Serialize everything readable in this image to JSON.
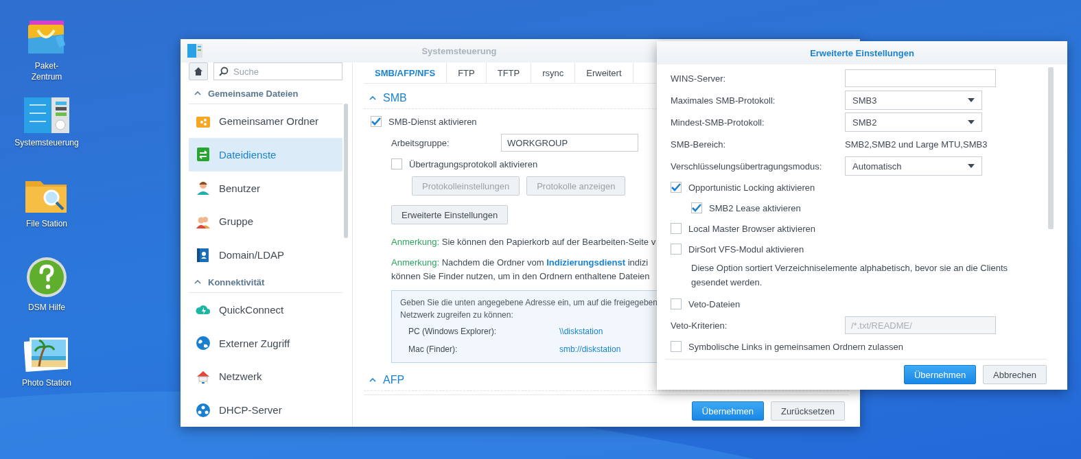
{
  "desktop_icons": [
    {
      "kind": "package",
      "label_lines": [
        "Paket-",
        "Zentrum"
      ]
    },
    {
      "kind": "control_panel",
      "label_lines": [
        "Systemsteuerung"
      ]
    },
    {
      "kind": "file_station",
      "label_lines": [
        "File Station"
      ]
    },
    {
      "kind": "help",
      "label_lines": [
        "DSM Hilfe"
      ]
    },
    {
      "kind": "photo",
      "label_lines": [
        "Photo Station"
      ]
    }
  ],
  "main_window": {
    "title": "Systemsteuerung",
    "search": {
      "placeholder": "Suche"
    },
    "sidebar": {
      "sections": [
        {
          "title": "Gemeinsame Dateien",
          "expanded": true,
          "items": [
            {
              "label": "Gemeinsamer Ordner",
              "selected": false
            },
            {
              "label": "Dateidienste",
              "selected": true
            },
            {
              "label": "Benutzer",
              "selected": false
            },
            {
              "label": "Gruppe",
              "selected": false
            },
            {
              "label": "Domain/LDAP",
              "selected": false
            }
          ]
        },
        {
          "title": "Konnektivität",
          "expanded": true,
          "items": [
            {
              "label": "QuickConnect",
              "selected": false
            },
            {
              "label": "Externer Zugriff",
              "selected": false
            },
            {
              "label": "Netzwerk",
              "selected": false
            },
            {
              "label": "DHCP-Server",
              "selected": false
            }
          ]
        }
      ]
    },
    "tabs": [
      {
        "label": "SMB/AFP/NFS",
        "selected": true
      },
      {
        "label": "FTP",
        "selected": false
      },
      {
        "label": "TFTP",
        "selected": false
      },
      {
        "label": "rsync",
        "selected": false
      },
      {
        "label": "Erweitert",
        "selected": false
      }
    ],
    "smb_section": {
      "title": "SMB",
      "expanded": true,
      "enable": {
        "label": "SMB-Dienst aktivieren",
        "checked": true
      },
      "workgroup": {
        "label": "Arbeitsgruppe:",
        "value": "WORKGROUP"
      },
      "transfer_log": {
        "label": "Übertragungsprotokoll aktivieren",
        "checked": false
      },
      "log_buttons": [
        {
          "label": "Protokolleinstellungen",
          "disabled": true
        },
        {
          "label": "Protokolle anzeigen",
          "disabled": true
        }
      ],
      "advanced_button": "Erweiterte Einstellungen",
      "notes": [
        {
          "prefix": "Anmerkung:",
          "lines": [
            {
              "before": "Sie können den Papierkorb auf der Bearbeiten-Seite v"
            }
          ]
        },
        {
          "prefix": "Anmerkung:",
          "lines": [
            {
              "before": "Nachdem die Ordner vom ",
              "link": "Indizierungsdienst",
              "after": " indizi"
            },
            {
              "before": "können Sie Finder nutzen, um in den Ordnern enthaltene Dateien"
            }
          ]
        }
      ],
      "info_box": {
        "lines": [
          "Geben Sie die unten angegebene Adresse ein, um auf die freigegeben",
          "Netzwerk zugreifen zu können:"
        ],
        "addresses": [
          {
            "label": "PC (Windows Explorer):",
            "value": "\\\\diskstation"
          },
          {
            "label": "Mac (Finder):",
            "value": "smb://diskstation"
          }
        ]
      }
    },
    "afp_section": {
      "title": "AFP",
      "expanded": true
    },
    "buttons": [
      {
        "label": "Übernehmen",
        "kind": "primary"
      },
      {
        "label": "Zurücksetzen",
        "kind": "default"
      }
    ]
  },
  "dialog": {
    "title": "Erweiterte Einstellungen",
    "rows": [
      {
        "kind": "input",
        "label": "WINS-Server:",
        "disabled": false
      },
      {
        "kind": "select",
        "label": "Maximales SMB-Protokoll:",
        "value": "SMB3"
      },
      {
        "kind": "select",
        "label": "Mindest-SMB-Protokoll:",
        "value": "SMB2"
      },
      {
        "kind": "static",
        "label": "SMB-Bereich:",
        "value": "SMB2,SMB2 und Large MTU,SMB3"
      },
      {
        "kind": "select",
        "label": "Verschlüsselungsübertragungsmodus:",
        "value": "Automatisch"
      },
      {
        "kind": "checkbox",
        "label": "Opportunistic Locking aktivieren",
        "checked": true,
        "children": [
          {
            "kind": "checkbox",
            "label": "SMB2 Lease aktivieren",
            "checked": true
          }
        ]
      },
      {
        "kind": "checkbox",
        "label": "Local Master Browser aktivieren",
        "checked": false
      },
      {
        "kind": "checkbox",
        "label": "DirSort VFS-Modul aktivieren",
        "checked": false
      },
      {
        "kind": "description",
        "text": "Diese Option sortiert Verzeichniselemente alphabetisch, bevor sie an die Clients gesendet werden."
      },
      {
        "kind": "checkbox",
        "label": "Veto-Dateien",
        "checked": false
      },
      {
        "kind": "input",
        "label": "Veto-Kriterien:",
        "placeholder": "/*.txt/README/",
        "disabled": true
      },
      {
        "kind": "checkbox",
        "label": "Symbolische Links in gemeinsamen Ordnern zulassen",
        "checked": false
      }
    ],
    "buttons": [
      {
        "label": "Übernehmen",
        "kind": "primary"
      },
      {
        "label": "Abbrechen",
        "kind": "default"
      }
    ]
  }
}
